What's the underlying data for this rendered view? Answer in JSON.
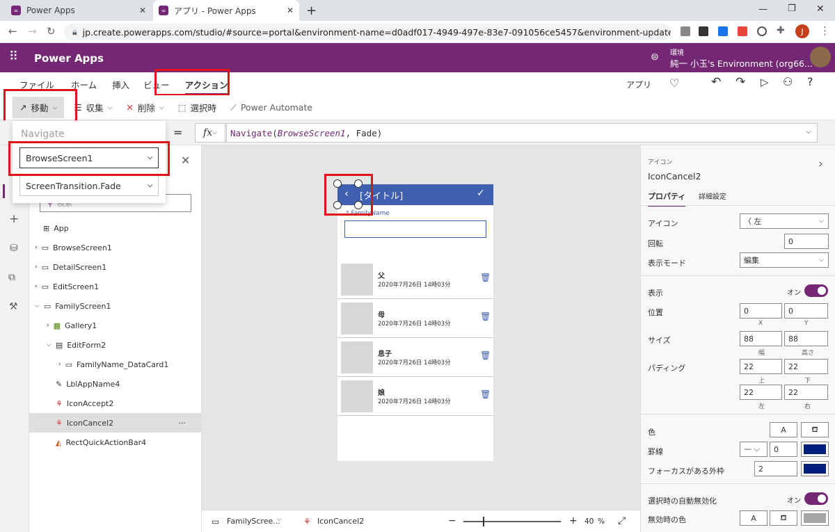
{
  "browser": {
    "tabs": [
      {
        "title": "Power Apps"
      },
      {
        "title": "アプリ - Power Apps"
      }
    ],
    "url": "jp.create.powerapps.com/studio/#source=portal&environment-name=d0adf017-4949-497e-83e7-091056ce5457&environment-update-cadence=...",
    "profile_initial": "J"
  },
  "app": {
    "title": "Power Apps",
    "env_label": "環境",
    "env_name": "純一 小玉's Environment (org66..."
  },
  "menu": {
    "items": [
      "ファイル",
      "ホーム",
      "挿入",
      "ビュー",
      "アクション"
    ],
    "active": "アクション",
    "app_label": "アプリ"
  },
  "commands": {
    "navigate": "移動",
    "collect": "収集",
    "remove": "削除",
    "onselect": "選択時",
    "power_automate": "Power Automate"
  },
  "formula": {
    "equals": "=",
    "fx": "fx",
    "text": "Navigate(BrowseScreen1, Fade)",
    "fn": "Navigate",
    "arg1": "BrowseScreen1",
    "arg2": "Fade"
  },
  "navigate_popup": {
    "title": "Navigate",
    "screen": "BrowseScreen1",
    "transition": "ScreenTransition.Fade"
  },
  "tree": {
    "search_placeholder": "検索",
    "nodes": [
      "App",
      "BrowseScreen1",
      "DetailScreen1",
      "EditScreen1",
      "FamilyScreen1",
      "Gallery1",
      "EditForm2",
      "FamilyName_DataCard1",
      "LblAppName4",
      "IconAccept2",
      "IconCancel2",
      "RectQuickActionBar4"
    ]
  },
  "phone": {
    "header_title": "[タイトル]",
    "field_label": "* FamilyName",
    "items": [
      {
        "name": "父",
        "date": "2020年7月26日 14時03分"
      },
      {
        "name": "母",
        "date": "2020年7月26日 14時03分"
      },
      {
        "name": "息子",
        "date": "2020年7月26日 14時03分"
      },
      {
        "name": "娘",
        "date": "2020年7月26日 14時03分"
      }
    ]
  },
  "status": {
    "screen": "FamilyScree...",
    "control": "IconCancel2",
    "zoom": "40",
    "zoom_unit": "%",
    "minus": "−",
    "plus": "+"
  },
  "props": {
    "type": "アイコン",
    "name": "IconCancel2",
    "tab_props": "プロパティ",
    "tab_adv": "詳細設定",
    "icon_label": "アイコン",
    "icon_value": "左",
    "rotation_label": "回転",
    "rotation": "0",
    "display_mode_label": "表示モード",
    "display_mode": "編集",
    "visible_label": "表示",
    "visible_state": "オン",
    "position_label": "位置",
    "x": "0",
    "y": "0",
    "x_label": "X",
    "y_label": "Y",
    "size_label": "サイズ",
    "width": "88",
    "height": "88",
    "width_label": "幅",
    "height_label": "高さ",
    "padding_label": "パディング",
    "pad_top": "22",
    "pad_bottom": "22",
    "pad_left": "22",
    "pad_right": "22",
    "top_label": "上",
    "bottom_label": "下",
    "left_label": "左",
    "right_label": "右",
    "color_label": "色",
    "color_a": "A",
    "border_label": "罫線",
    "border_width": "0",
    "focus_label": "フォーカスがある外枠",
    "focus_width": "2",
    "auto_disable_label": "選択時の自動無効化",
    "auto_disable_state": "オン",
    "disabled_color_label": "無効時の色",
    "border_color": "#001e7c",
    "accent": "#742774"
  }
}
